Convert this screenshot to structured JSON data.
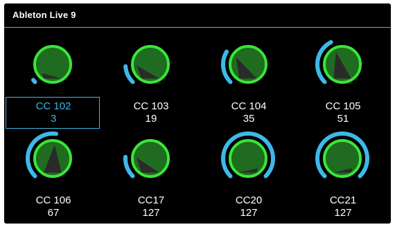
{
  "window": {
    "title": "Ableton Live 9"
  },
  "colors": {
    "background": "#000000",
    "accent": "#3fb8e8",
    "knob_ring": "#39e639",
    "knob_fill": "#1f6b1f",
    "pointer": "#2a2a2a",
    "text": "#ffffff"
  },
  "controls": [
    {
      "name": "CC 102",
      "value": "3",
      "level": 0.02,
      "selected": true,
      "icon": "knob-icon"
    },
    {
      "name": "CC 103",
      "value": "19",
      "level": 0.15,
      "selected": false,
      "icon": "knob-icon"
    },
    {
      "name": "CC 104",
      "value": "35",
      "level": 0.28,
      "selected": false,
      "icon": "knob-icon"
    },
    {
      "name": "CC 105",
      "value": "51",
      "level": 0.4,
      "selected": false,
      "icon": "knob-icon"
    },
    {
      "name": "CC 106",
      "value": "67",
      "level": 0.53,
      "selected": false,
      "icon": "knob-icon"
    },
    {
      "name": "CC17",
      "value": "127",
      "level": 0.18,
      "selected": false,
      "icon": "knob-icon"
    },
    {
      "name": "CC20",
      "value": "127",
      "level": 1.0,
      "selected": false,
      "icon": "knob-icon"
    },
    {
      "name": "CC21",
      "value": "127",
      "level": 1.0,
      "selected": false,
      "icon": "knob-icon"
    }
  ]
}
